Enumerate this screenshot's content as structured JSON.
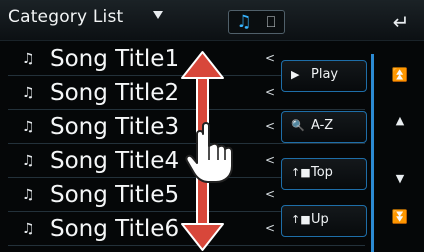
{
  "header": {
    "title": "Category List",
    "title_dropdown_icon": "caret-down-icon",
    "mode_buttons": [
      {
        "name": "music-note-icon",
        "glyph": "♫",
        "active": true,
        "color": "#38b4ff"
      },
      {
        "name": "square-icon",
        "glyph": "⎕",
        "active": false
      }
    ],
    "back_icon": "back-arrow-icon",
    "back_glyph": "↵"
  },
  "list": {
    "note_glyph": "♫",
    "chevron_glyph": "<",
    "items": [
      {
        "label": "Song Title1"
      },
      {
        "label": "Song Title2"
      },
      {
        "label": "Song Title3"
      },
      {
        "label": "Song Title4"
      },
      {
        "label": "Song Title5"
      },
      {
        "label": "Song Title6"
      }
    ]
  },
  "side_buttons": [
    {
      "icon": "play-icon",
      "glyph": "▶",
      "label": "Play"
    },
    {
      "icon": "search-icon",
      "glyph": "🔍",
      "label": "A-Z"
    },
    {
      "icon": "top-folder-icon",
      "glyph": "↑■",
      "label": "Top"
    },
    {
      "icon": "up-folder-icon",
      "glyph": "↑■",
      "label": "Up"
    }
  ],
  "scroll_controls": [
    {
      "icon": "scroll-to-top-icon",
      "glyph": "⏫"
    },
    {
      "icon": "page-up-icon",
      "glyph": "▲"
    },
    {
      "icon": "page-down-icon",
      "glyph": "▼"
    },
    {
      "icon": "scroll-to-bottom-icon",
      "glyph": "⏬"
    }
  ],
  "gesture_overlay": {
    "icon": "swipe-gesture-icon",
    "arrow_color": "#e0493a"
  }
}
